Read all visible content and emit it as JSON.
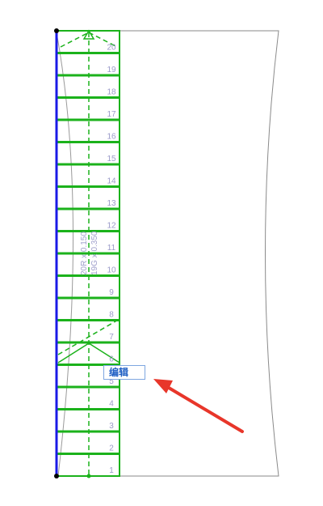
{
  "stair": {
    "riser_label": "20R x 0.150",
    "tread_label": "19G x 0.350",
    "step_numbers": [
      "1",
      "2",
      "3",
      "4",
      "5",
      "6",
      "7",
      "8",
      "9",
      "10",
      "11",
      "12",
      "13",
      "14",
      "15",
      "16",
      "17",
      "18",
      "19",
      "20"
    ]
  },
  "edit_popup": {
    "label": "编辑"
  },
  "colors": {
    "stair_green": "#1bb21b",
    "boundary_blue": "#1a1ae6",
    "outline_gray": "#8a8a8a",
    "step_number_color": "#9a9ac8",
    "arrow_red": "#e8362a",
    "popup_text": "#1f5fc4",
    "popup_border": "#7ea6e0"
  },
  "icons": {
    "annotation_arrow": "red-arrow-icon",
    "vertex_dot": "black-dot-icon"
  }
}
